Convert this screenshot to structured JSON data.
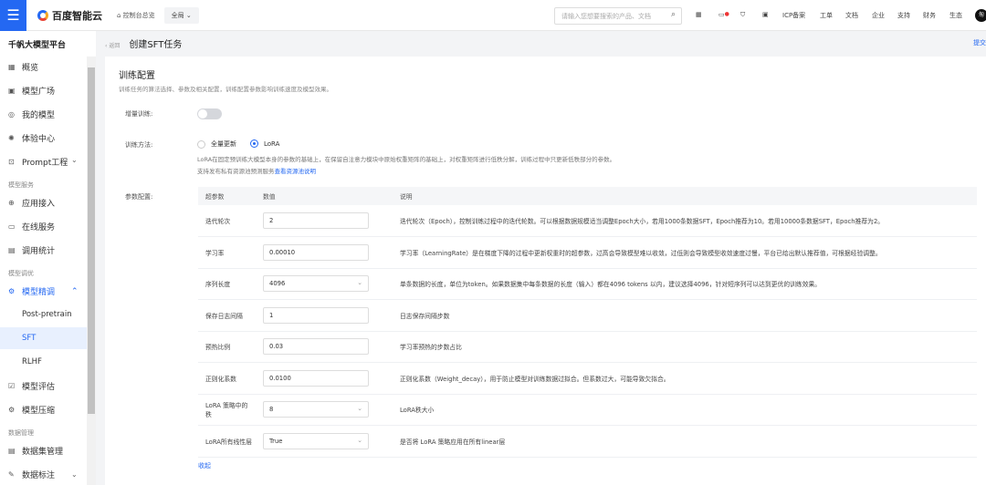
{
  "topbar": {
    "brand": "百度智能云",
    "home": "控制台总览",
    "scope": "全局",
    "search_placeholder": "请输入您想要搜索的产品、文档",
    "nav": [
      "ICP备案",
      "工单",
      "文档",
      "企业",
      "支持",
      "财务",
      "生态"
    ],
    "avatar": "匆"
  },
  "sidebar": {
    "title": "千帆大模型平台",
    "items": [
      {
        "label": "概览",
        "icon": "▦"
      },
      {
        "label": "模型广场",
        "icon": "▣"
      },
      {
        "label": "我的模型",
        "icon": "◎"
      },
      {
        "label": "体验中心",
        "icon": "✺"
      },
      {
        "label": "Prompt工程",
        "icon": "⊡"
      }
    ],
    "section1": "模型服务",
    "items2": [
      {
        "label": "应用接入",
        "icon": "⊕"
      },
      {
        "label": "在线服务",
        "icon": "▭"
      },
      {
        "label": "调用统计",
        "icon": "▤"
      }
    ],
    "section2": "模型调优",
    "tuning": "模型精调",
    "tuning_subs": [
      "Post-pretrain",
      "SFT",
      "RLHF"
    ],
    "items3": [
      {
        "label": "模型评估",
        "icon": "☑"
      },
      {
        "label": "模型压缩",
        "icon": "⚙"
      }
    ],
    "section3": "数据管理",
    "items4": [
      {
        "label": "数据集管理",
        "icon": "▤"
      },
      {
        "label": "数据标注",
        "icon": "✎"
      }
    ]
  },
  "header": {
    "back": "返回",
    "title": "创建SFT任务",
    "submit": "提交"
  },
  "config": {
    "title": "训练配置",
    "desc": "训练任务的算法选择、参数及相关配置，训练配置参数影响训练速度及模型效果。",
    "incremental_label": "增量训练:",
    "incremental_on": false,
    "method_label": "训练方法:",
    "methods": [
      "全量更新",
      "LoRA"
    ],
    "method_selected": "LoRA",
    "lora_note": "LoRA在固定预训练大模型本身的参数的基础上，在保留自注意力模块中原始权重矩阵的基础上，对权重矩阵进行低秩分解，训练过程中只更新低秩部分的参数。",
    "pool_note": "支持发布私有资源池预测服务",
    "pool_link": "查看资源池说明",
    "params_label": "参数配置:",
    "columns": [
      "超参数",
      "数值",
      "说明"
    ],
    "rows": [
      {
        "name": "迭代轮次",
        "value": "2",
        "select": false,
        "desc": "迭代轮次（Epoch），控制训练过程中的迭代轮数。可以根据数据规模适当调整Epoch大小，若用1000条数据SFT，Epoch推荐为10。若用10000条数据SFT，Epoch推荐为2。"
      },
      {
        "name": "学习率",
        "value": "0.00010",
        "select": false,
        "desc": "学习率（LearningRate）是在梯度下降的过程中更新权重时的超参数，过高会导致模型难以收敛，过低则会导致模型收敛速度过慢，平台已给出默认推荐值，可根据经验调整。"
      },
      {
        "name": "序列长度",
        "value": "4096",
        "select": true,
        "desc": "单条数据的长度，单位为token。如果数据集中每条数据的长度（输入）都在4096 tokens 以内，建议选择4096，针对短序列可以达到更优的训练效果。"
      },
      {
        "name": "保存日志间隔",
        "value": "1",
        "select": false,
        "desc": "日志保存间隔步数"
      },
      {
        "name": "预热比例",
        "value": "0.03",
        "select": false,
        "desc": "学习率预热的步数占比"
      },
      {
        "name": "正则化系数",
        "value": "0.0100",
        "select": false,
        "desc": "正则化系数（Weight_decay），用于防止模型对训练数据过拟合。但系数过大，可能导致欠拟合。"
      },
      {
        "name": "LoRA 策略中的秩",
        "value": "8",
        "select": true,
        "desc": "LoRA秩大小"
      },
      {
        "name": "LoRA所有线性层",
        "value": "True",
        "select": true,
        "desc": "是否将 LoRA 策略应用在所有linear层"
      }
    ],
    "collapse": "收起"
  }
}
